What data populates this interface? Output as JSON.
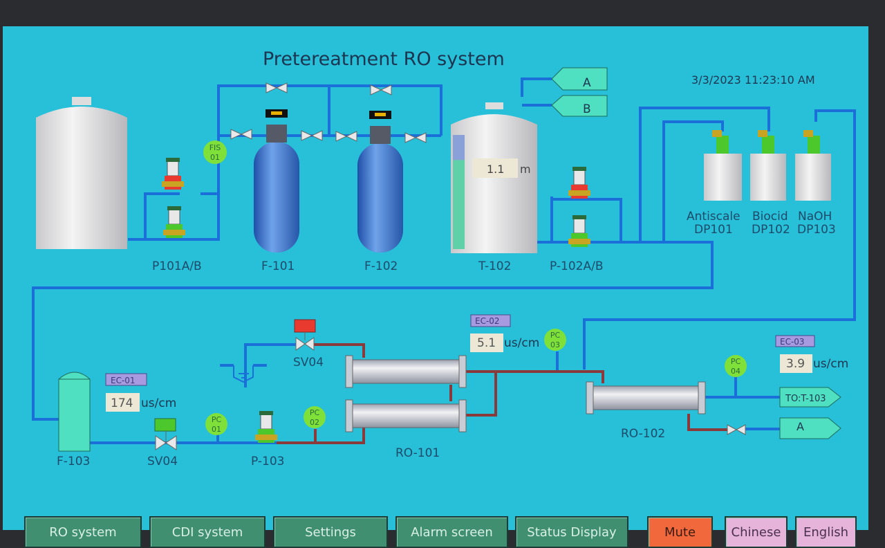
{
  "header": {
    "title": "Pretereatment RO system",
    "datetime": "3/3/2023 11:23:10 AM"
  },
  "equipment": {
    "pump_p101": "P101A/B",
    "fis": {
      "line1": "FIS",
      "line2": "01"
    },
    "f101": "F-101",
    "f102": "F-102",
    "t102": {
      "label": "T-102",
      "level_value": "1.1",
      "level_unit": "m",
      "level_fill_percent": 78
    },
    "pump_p102": "P-102A/B",
    "tag_a": "A",
    "tag_b": "B",
    "dosing": [
      {
        "name": "Antiscale",
        "code": "DP101"
      },
      {
        "name": "Biocid",
        "code": "DP102"
      },
      {
        "name": "NaOH",
        "code": "DP103"
      }
    ],
    "f103": "F-103",
    "sv04_inlet": "SV04",
    "sv04_flush": "SV04",
    "p103": "P-103",
    "pc01": {
      "line1": "PC",
      "line2": "01"
    },
    "pc02": {
      "line1": "PC",
      "line2": "02"
    },
    "pc03": {
      "line1": "PC",
      "line2": "03"
    },
    "pc04": {
      "line1": "PC",
      "line2": "04"
    },
    "ec01": {
      "label": "EC-01",
      "value": "174",
      "unit": "us/cm"
    },
    "ec02": {
      "label": "EC-02",
      "value": "5.1",
      "unit": "us/cm"
    },
    "ec03": {
      "label": "EC-03",
      "value": "3.9",
      "unit": "us/cm"
    },
    "ro101": "RO-101",
    "ro102": "RO-102",
    "tag_to_t103": "TO:T-103",
    "tag_a_out": "A"
  },
  "colors": {
    "background": "#27c0d8",
    "water_pipe": "#1a6fd8",
    "concentrate_pipe": "#8a3a3a",
    "running": "#4cc82c",
    "stopped": "#e83a2e",
    "mute": "#f0683c",
    "language": "#e6b4da"
  },
  "nav": {
    "ro_system": "RO system",
    "cdi_system": "CDI  system",
    "settings": "Settings",
    "alarm_screen": "Alarm screen",
    "status_display": "Status Display",
    "mute": "Mute",
    "chinese": "Chinese",
    "english": "English"
  }
}
